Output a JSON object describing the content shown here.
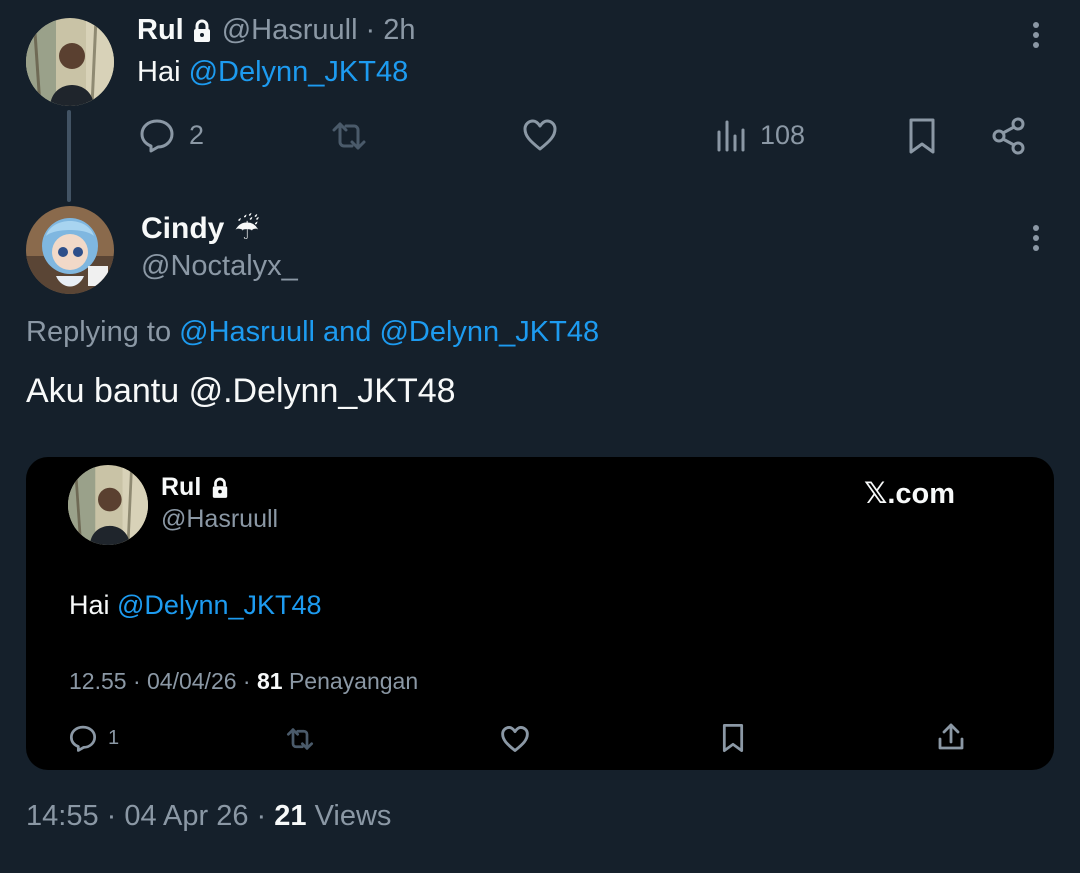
{
  "parent": {
    "name": "Rul",
    "handle": "@Hasruull",
    "time": "· 2h",
    "text_prefix": "Hai ",
    "mention": "@Delynn_JKT48",
    "reply_count": "2",
    "view_count": "108"
  },
  "reply": {
    "name": "Cindy",
    "name_emoji": "☔",
    "handle": "@Noctalyx_",
    "replying_prefix": "Replying to ",
    "replying_to": "@Hasruull and @Delynn_JKT48",
    "text": "Aku bantu @.Delynn_JKT48"
  },
  "card": {
    "name": "Rul",
    "handle": "@Hasruull",
    "brand": "𝕏.com",
    "text_prefix": "Hai ",
    "mention": "@Delynn_JKT48",
    "meta_time": "12.55 · 04/04/26 · ",
    "meta_views": "81",
    "meta_views_label": " Penayangan",
    "reply_count": "1"
  },
  "footer": {
    "time": "14:55 · 04 Apr 26 · ",
    "views": "21",
    "views_label": " Views"
  },
  "colors": {
    "background": "#15202b",
    "accent": "#1d9bf0",
    "muted": "#8b98a5",
    "card": "#000000"
  }
}
